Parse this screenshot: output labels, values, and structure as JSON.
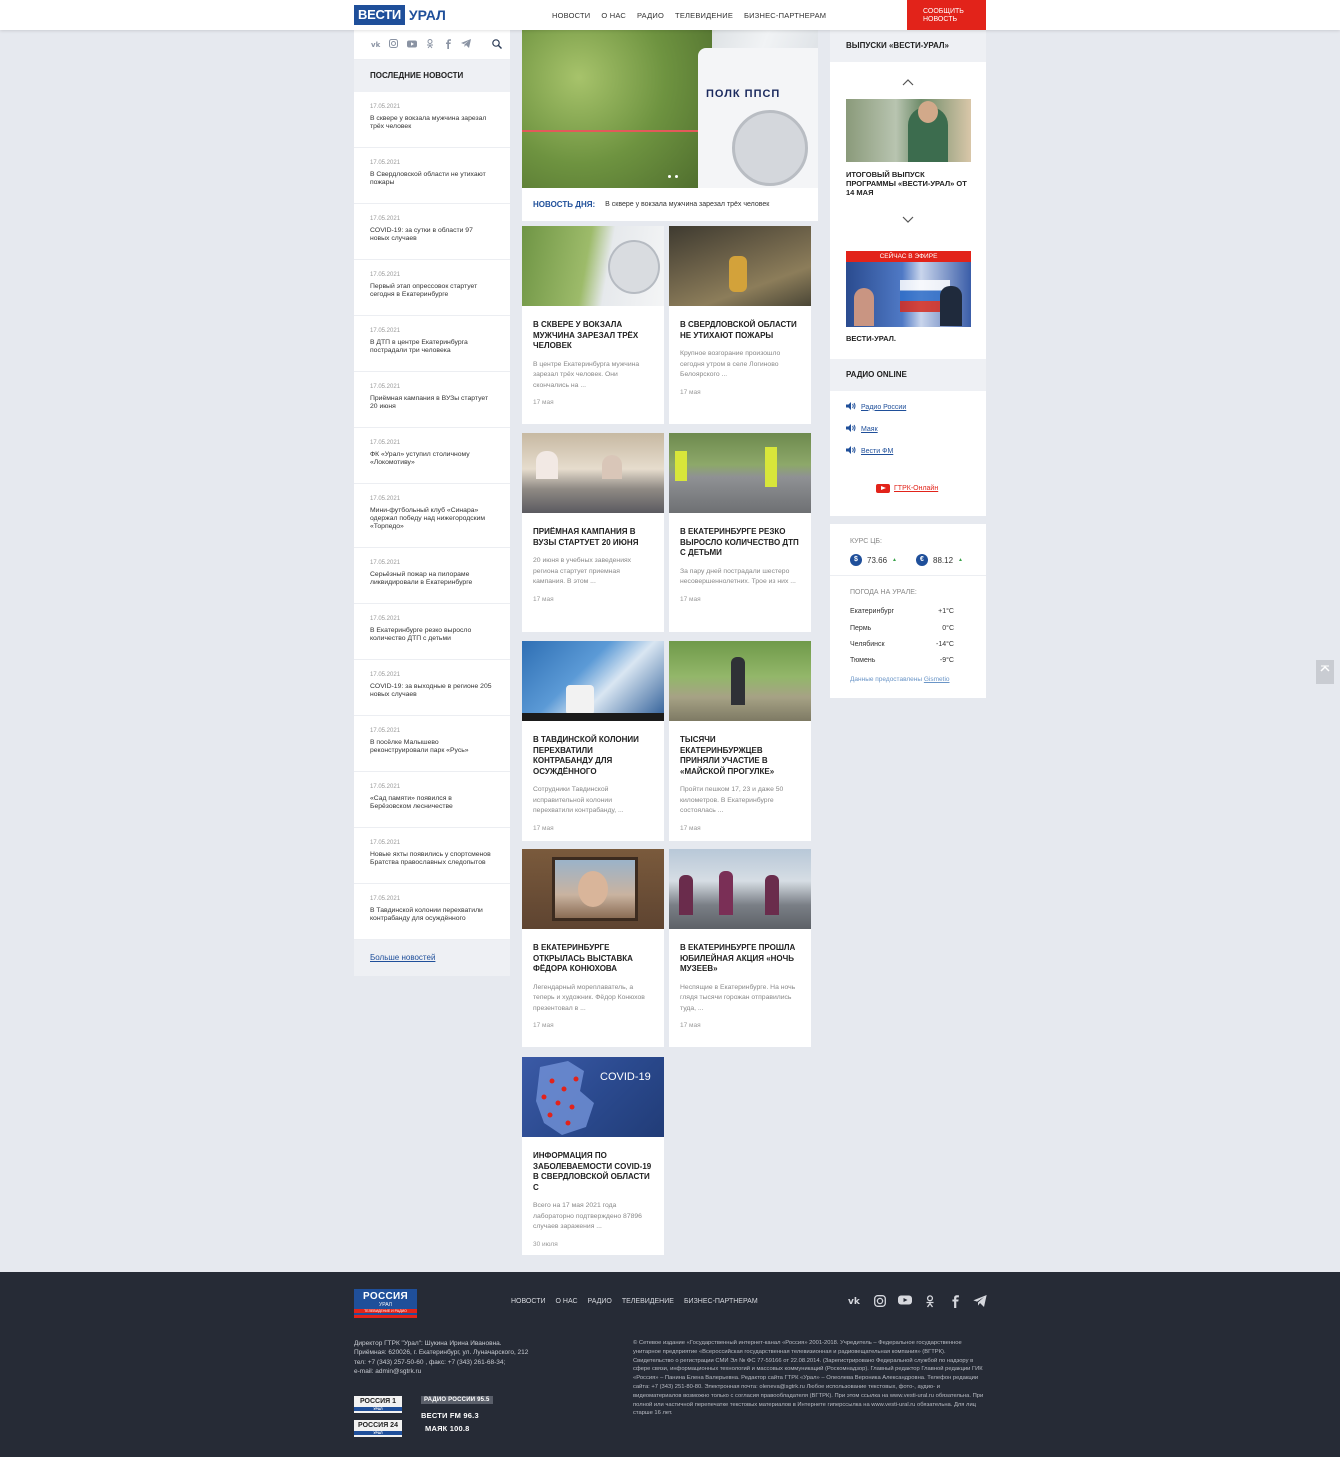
{
  "header": {
    "logo_main": "ВЕСТИ",
    "logo_region": "УРАЛ",
    "nav": [
      "НОВОСТИ",
      "О НАС",
      "РАДИО",
      "ТЕЛЕВИДЕНИЕ",
      "БИЗНЕС-ПАРТНЕРАМ"
    ],
    "report_btn_line1": "СООБЩИТЬ",
    "report_btn_line2": "НОВОСТЬ"
  },
  "left": {
    "social_icons": [
      "vk-icon",
      "instagram-icon",
      "youtube-icon",
      "odnoklassniki-icon",
      "facebook-icon",
      "telegram-icon"
    ],
    "title": "ПОСЛЕДНИЕ НОВОСТИ",
    "news": [
      {
        "date": "17.05.2021",
        "title": "В сквере у вокзала мужчина зарезал трёх человек"
      },
      {
        "date": "17.05.2021",
        "title": "В Свердловской области не утихают пожары"
      },
      {
        "date": "17.05.2021",
        "title": "COVID-19: за сутки в области 97 новых случаев"
      },
      {
        "date": "17.05.2021",
        "title": "Первый этап опрессовок стартует сегодня в Екатеринбурге"
      },
      {
        "date": "17.05.2021",
        "title": "В ДТП в центре Екатеринбурга пострадали три человека"
      },
      {
        "date": "17.05.2021",
        "title": "Приёмная кампания в ВУЗы стартует 20 июня"
      },
      {
        "date": "17.05.2021",
        "title": "ФК «Урал» уступил столичному «Локомотиву»"
      },
      {
        "date": "17.05.2021",
        "title": "Мини-футбольный клуб «Синара» одержал победу над нижегородским «Торпедо»"
      },
      {
        "date": "17.05.2021",
        "title": "Серьёзный пожар на пилораме ликвидировали в Екатеринбурге"
      },
      {
        "date": "17.05.2021",
        "title": "В Екатеринбурге резко выросло количество ДТП с детьми"
      },
      {
        "date": "17.05.2021",
        "title": "COVID-19: за выходные в регионе 205 новых случаев"
      },
      {
        "date": "17.05.2021",
        "title": "В посёлке Малышево реконструировали парк «Русь»"
      },
      {
        "date": "17.05.2021",
        "title": "«Сад памяти» появился в Берёзовском лесничестве"
      },
      {
        "date": "17.05.2021",
        "title": "Новые яхты появились у спортсменов Братства православных следопытов"
      },
      {
        "date": "17.05.2021",
        "title": "В Тавдинской колонии перехватили контрабанду для осуждённого"
      }
    ],
    "more": "Больше новостей"
  },
  "hero": {
    "car_text": "ПОЛК ППСП",
    "label": "НОВОСТЬ ДНЯ:",
    "text": "В сквере у вокзала мужчина зарезал трёх человек"
  },
  "cards": [
    {
      "title": "В СКВЕРЕ У ВОКЗАЛА МУЖЧИНА ЗАРЕЗАЛ ТРЁХ ЧЕЛОВЕК",
      "lead": "В центре Екатеринбурга мужчина зарезал трёх человек. Они скончались на ...",
      "date": "17 мая"
    },
    {
      "title": "В СВЕРДЛОВСКОЙ ОБЛАСТИ НЕ УТИХАЮТ ПОЖАРЫ",
      "lead": "Крупное возгорание произошло сегодня утром в селе Логиново Белоярского ...",
      "date": "17 мая"
    },
    {
      "title": "ПРИЁМНАЯ КАМПАНИЯ В ВУЗЫ СТАРТУЕТ 20 ИЮНЯ",
      "lead": "20 июня в учебных заведениях региона стартует приемная кампания. В этом ...",
      "date": "17 мая"
    },
    {
      "title": "В ЕКАТЕРИНБУРГЕ РЕЗКО ВЫРОСЛО КОЛИЧЕСТВО ДТП С ДЕТЬМИ",
      "lead": "За пару дней пострадали шестеро несовершеннолетних.   Трое из них ...",
      "date": "17 мая"
    },
    {
      "title": "В ТАВДИНСКОЙ КОЛОНИИ ПЕРЕХВАТИЛИ КОНТРАБАНДУ ДЛЯ ОСУЖДЁННОГО",
      "lead": "Сотрудники Тавдинской исправительной колонии перехватили контрабанду, ...",
      "date": "17 мая"
    },
    {
      "title": "ТЫСЯЧИ ЕКАТЕРИНБУРЖЦЕВ ПРИНЯЛИ УЧАСТИЕ В «МАЙСКОЙ ПРОГУЛКЕ»",
      "lead": "Пройти пешком 17, 23 и даже 50 километров. В Екатеринбурге состоялась ...",
      "date": "17 мая"
    },
    {
      "title": "В ЕКАТЕРИНБУРГЕ ОТКРЫЛАСЬ ВЫСТАВКА ФЁДОРА КОНЮХОВА",
      "lead": "Легендарный мореплаватель, а теперь и художник. Фёдор Конюхов презентовал в ...",
      "date": "17 мая"
    },
    {
      "title": "В ЕКАТЕРИНБУРГЕ ПРОШЛА ЮБИЛЕЙНАЯ АКЦИЯ «НОЧЬ МУЗЕЕВ»",
      "lead": "Неспящие в Екатеринбурге. На ночь глядя тысячи горожан отправились туда, ...",
      "date": "17 мая"
    },
    {
      "title": "ИНФОРМАЦИЯ ПО ЗАБОЛЕВАЕМОСТИ COVID-19 В СВЕРДЛОВСКОЙ ОБЛАСТИ С",
      "lead": "Всего на 17 мая 2021 года лабораторно подтверждено 87896 случаев заражения ...",
      "date": "30 июля",
      "image_text": "COVID-19"
    }
  ],
  "right": {
    "releases_title": "ВЫПУСКИ «ВЕСТИ-УРАЛ»",
    "video_title": "ИТОГОВЫЙ ВЫПУСК ПРОГРАММЫ «ВЕСТИ-УРАЛ» ОТ 14 МАЯ",
    "live_bar": "СЕЙЧАС В ЭФИРЕ",
    "live_label": "ВЕСТИ-УРАЛ.",
    "radio_title": "РАДИО ONLINE",
    "radio_links": [
      "Радио России",
      "Маяк",
      "Вести ФМ"
    ],
    "youtube_link": "ГТРК-Онлайн",
    "currency_label": "КУРС ЦБ:",
    "usd": "73.66",
    "eur": "88.12",
    "weather_label": "ПОГОДА НА УРАЛЕ:",
    "weather": [
      {
        "city": "Екатеринбург",
        "temp": "+1°C"
      },
      {
        "city": "Пермь",
        "temp": "0°C"
      },
      {
        "city": "Челябинск",
        "temp": "-14°C"
      },
      {
        "city": "Тюмень",
        "temp": "-9°C"
      }
    ],
    "gismeteo_prefix": "Данные предоставлены",
    "gismeteo_link": "Gismetio"
  },
  "footer": {
    "logo_main": "РОССИЯ",
    "logo_region": "УРАЛ",
    "logo_sub": "ТЕЛЕВИДЕНИЕ И РАДИО",
    "nav": [
      "НОВОСТИ",
      "О НАС",
      "РАДИО",
      "ТЕЛЕВИДЕНИЕ",
      "БИЗНЕС-ПАРТНЕРАМ"
    ],
    "contacts": [
      "Директор ГТРК \"Урал\": Шукина Ирина Ивановна.",
      "Приёмная: 620026, г. Екатеринбург, ул. Луначарского, 212",
      "тел: +7 (343) 257-50-60 , факс: +7 (343) 261-68-34;",
      "e-mail: admin@sgtrk.ru"
    ],
    "copyright": "© Сетевое издание «Государственный интернет-канал «Россия» 2001-2018. Учредитель – Федеральное государственное унитарное предприятие «Всероссийская государственная телевизионная и радиовещательная компания» (ВГТРК). Свидетельство о регистрации СМИ Эл № ФС 77-59166 от 22.08.2014. (Зарегистрировано Федеральной службой по надзору в сфере связи, информационных технологий и массовых коммуникаций (Роскомнадзор). Главный редактор Главной редакции ГИК «Россия» – Панина Елена Валерьевна. Редактор сайта ГТРК «Урал» – Олеолева Вероника Александровна. Телефон редакции сайта: +7 (343) 251-80-80. Электронная почта: oleneva@sgtrk.ru Любое использование текстовых, фото-, аудио- и видеоматериалов возможно только с согласия правообладателя (ВГТРК). При этом ссылка на www.vesti-ural.ru обязательна. При полной или частичной перепечатке текстовых материалов в Интернете гиперссылка на www.vesti-ural.ru обязательна. Для лиц старше 16 лет.",
    "badge1": "РОССИЯ 1",
    "badge2": "РОССИЯ 24",
    "badge_sub": "УРАЛ",
    "radio1": "РАДИО РОССИИ 95.5",
    "radio2": "ВЕСТИ FM 96.3",
    "radio3": "МАЯК 100.8"
  }
}
